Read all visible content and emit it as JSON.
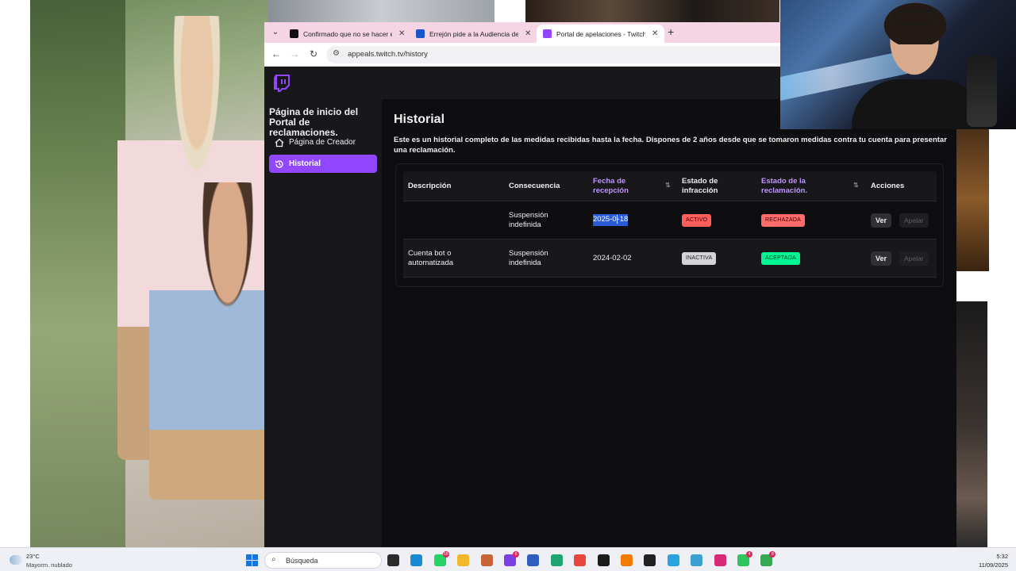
{
  "browser": {
    "tabs": [
      {
        "label": "Confirmado que no se hacer e",
        "favicon_color": "#111111",
        "active": false
      },
      {
        "label": "Errejón pide a la Audiencia de ",
        "favicon_color": "#1a56c9",
        "active": false
      },
      {
        "label": "Portal de apelaciones - Twitch",
        "favicon_color": "#9147ff",
        "active": true
      }
    ],
    "url": "appeals.twitch.tv/history"
  },
  "sidebar": {
    "title": "Página de inicio del Portal de reclamaciones.",
    "items": [
      {
        "label": "Página de Creador",
        "active": false
      },
      {
        "label": "Historial",
        "active": true
      }
    ]
  },
  "main": {
    "title": "Historial",
    "description": "Este es un historial completo de las medidas recibidas hasta la fecha. Dispones de 2 años desde que se tomaron medidas contra tu cuenta para presentar una reclamación."
  },
  "table": {
    "headers": {
      "description": "Descripción",
      "consequence": "Consecuencia",
      "received_date": "Fecha de recepción",
      "infraction_status": "Estado de infracción",
      "claim_status": "Estado de la reclamación.",
      "actions": "Acciones"
    },
    "rows": [
      {
        "description": "",
        "consequence": "Suspensión indefinida",
        "date_a": "2025-0",
        "date_b": "-18",
        "infraction_status": "ACTIVO",
        "claim_status": "RECHAZADA",
        "view": "Ver",
        "appeal": "Apelar"
      },
      {
        "description": "Cuenta bot o automatizada",
        "consequence": "Suspensión indefinida",
        "date": "2024-02-02",
        "infraction_status": "INACTIVA",
        "claim_status": "ACEPTADA",
        "view": "Ver",
        "appeal": "Apelar"
      }
    ]
  },
  "taskbar": {
    "weather_temp": "23°C",
    "weather_desc": "Mayorm. nublado",
    "search_placeholder": "Búsqueda",
    "apps": [
      {
        "name": "task-view",
        "color": "#2b2b2b",
        "badge": ""
      },
      {
        "name": "edge",
        "color": "#1a8ad4",
        "badge": ""
      },
      {
        "name": "whatsapp",
        "color": "#25d366",
        "badge": "16"
      },
      {
        "name": "file-explorer",
        "color": "#f2b72a",
        "badge": ""
      },
      {
        "name": "paint",
        "color": "#c7643a",
        "badge": ""
      },
      {
        "name": "app-purple",
        "color": "#7b3fe4",
        "badge": "6"
      },
      {
        "name": "store",
        "color": "#2d5fbf",
        "badge": ""
      },
      {
        "name": "app-green",
        "color": "#1ea672",
        "badge": ""
      },
      {
        "name": "chrome",
        "color": "#e8453c",
        "badge": ""
      },
      {
        "name": "media",
        "color": "#1b1b1b",
        "badge": ""
      },
      {
        "name": "rtve",
        "color": "#f07d00",
        "badge": ""
      },
      {
        "name": "app-dark",
        "color": "#222222",
        "badge": ""
      },
      {
        "name": "telegram",
        "color": "#2aa3df",
        "badge": ""
      },
      {
        "name": "app-blue",
        "color": "#3a9fd1",
        "badge": ""
      },
      {
        "name": "instagram",
        "color": "#d62976",
        "badge": ""
      },
      {
        "name": "app-lime",
        "color": "#2fc45d",
        "badge": "4"
      },
      {
        "name": "chrome-2",
        "color": "#34a853",
        "badge": "8"
      }
    ],
    "time": "5:32",
    "date": "11/09/2025"
  }
}
